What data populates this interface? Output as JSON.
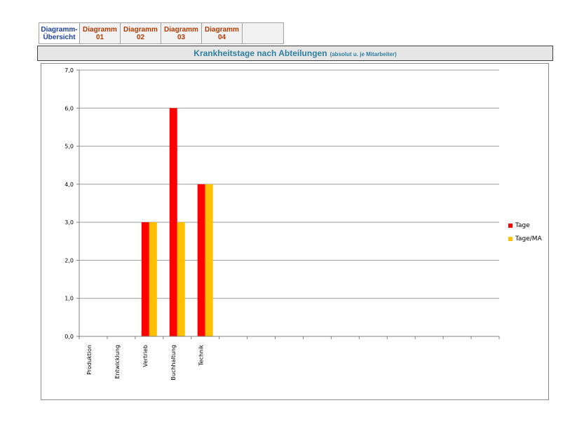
{
  "tabs": [
    {
      "line1": "Diagramm-",
      "line2": "Übersicht",
      "active": true
    },
    {
      "line1": "Diagramm",
      "line2": "01",
      "active": false
    },
    {
      "line1": "Diagramm",
      "line2": "02",
      "active": false
    },
    {
      "line1": "Diagramm",
      "line2": "03",
      "active": false
    },
    {
      "line1": "Diagramm",
      "line2": "04",
      "active": false
    }
  ],
  "header": {
    "title": "Krankheitstage nach Abteilungen",
    "subtitle": "(absolut u. je Mitarbeiter)"
  },
  "chart_data": {
    "type": "bar",
    "categories": [
      "Produktion",
      "Entwicklung",
      "Vertrieb",
      "Buchhaltung",
      "Technik",
      "",
      "",
      "",
      "",
      "",
      "",
      "",
      "",
      "",
      ""
    ],
    "series": [
      {
        "name": "Tage",
        "color": "#ff0000",
        "values": [
          0,
          0,
          3,
          6,
          4,
          0,
          0,
          0,
          0,
          0,
          0,
          0,
          0,
          0,
          0
        ]
      },
      {
        "name": "Tage/MA",
        "color": "#ffc000",
        "values": [
          0,
          0,
          3,
          3,
          4,
          0,
          0,
          0,
          0,
          0,
          0,
          0,
          0,
          0,
          0
        ]
      }
    ],
    "ylim": [
      0,
      7
    ],
    "yticks": [
      "0,0",
      "1,0",
      "2,0",
      "3,0",
      "4,0",
      "5,0",
      "6,0",
      "7,0"
    ],
    "grid": true,
    "legend_position": "right"
  }
}
